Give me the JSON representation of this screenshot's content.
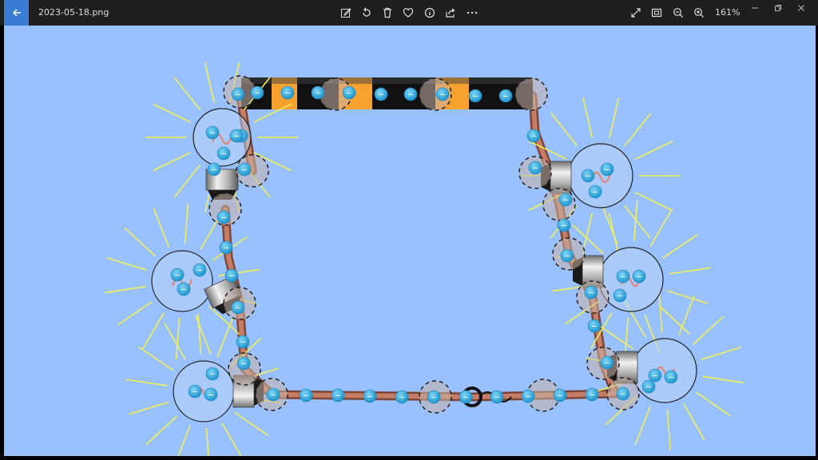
{
  "titlebar": {
    "filename": "2023-05-18.png",
    "zoom_level": "161%",
    "icons": [
      "back-arrow-icon",
      "edit-image-icon",
      "rotate-icon",
      "delete-icon",
      "favorite-heart-icon",
      "info-icon",
      "share-icon",
      "more-options-icon",
      "fullscreen-icon",
      "fit-to-window-icon",
      "zoom-out-icon",
      "zoom-in-icon",
      "minimize-icon",
      "restore-icon",
      "close-icon"
    ]
  },
  "image": {
    "description_colors": {
      "background": "#99c1ff",
      "wire": "#b5705a",
      "electron": "#29a9e0",
      "battery_band": "#f7a12e",
      "rays": "#f0f05a"
    },
    "electron_symbol": "−"
  }
}
